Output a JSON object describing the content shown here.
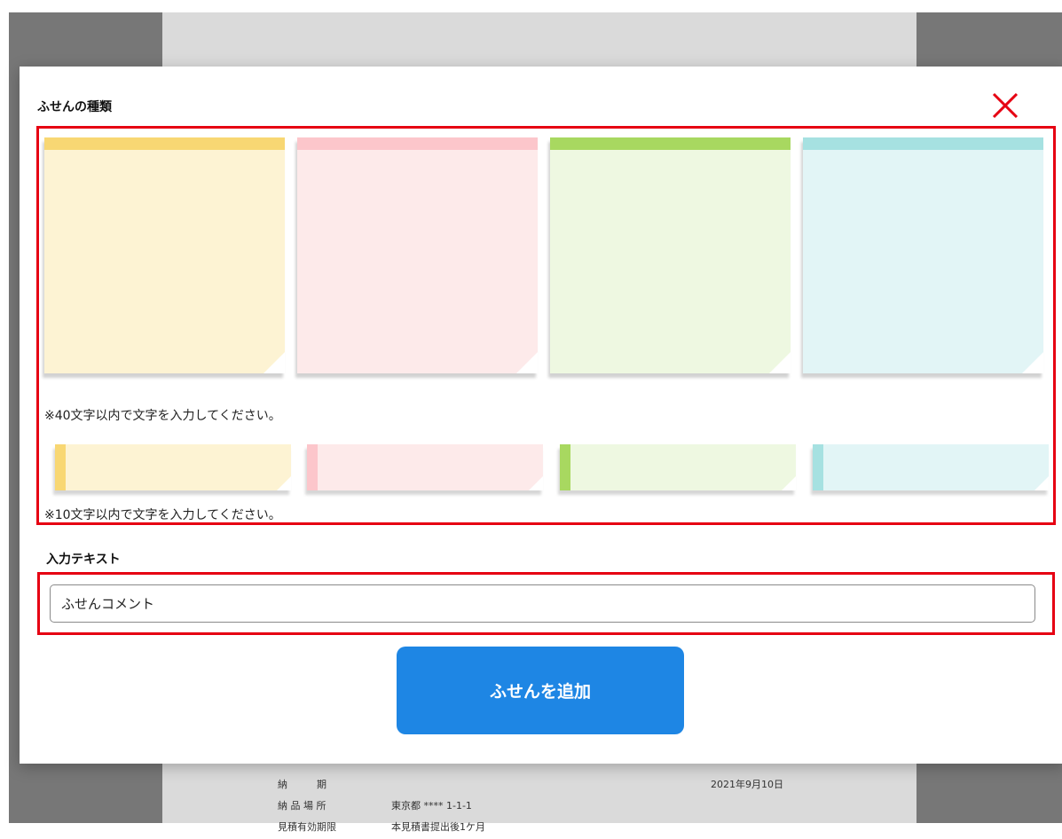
{
  "dialog": {
    "title": "ふせんの種類",
    "close_icon": "close-icon"
  },
  "colors": {
    "yellow": {
      "band": "#f8d773",
      "body": "#fdf3d3"
    },
    "pink": {
      "band": "#fcc6cb",
      "body": "#fdeaea"
    },
    "green": {
      "band": "#a8d860",
      "body": "#eef8e1"
    },
    "cyan": {
      "band": "#a6e1e1",
      "body": "#e2f5f6"
    },
    "highlight": "#e60012",
    "button": "#1e86e4"
  },
  "large_notes": {
    "hint": "※40文字以内で文字を入力してください。"
  },
  "small_notes": {
    "hint": "※10文字以内で文字を入力してください。"
  },
  "input": {
    "label": "入力テキスト",
    "value": "ふせんコメント"
  },
  "add_button": {
    "label": "ふせんを追加"
  },
  "background_document": {
    "rows": [
      {
        "label": "納　　　期",
        "value": "",
        "extra": "2021年9月10日"
      },
      {
        "label": "納 品 場 所",
        "value": "東京都 **** 1-1-1",
        "extra": ""
      },
      {
        "label": "見積有効期限",
        "value": "本見積書提出後1ケ月",
        "extra": ""
      }
    ]
  }
}
